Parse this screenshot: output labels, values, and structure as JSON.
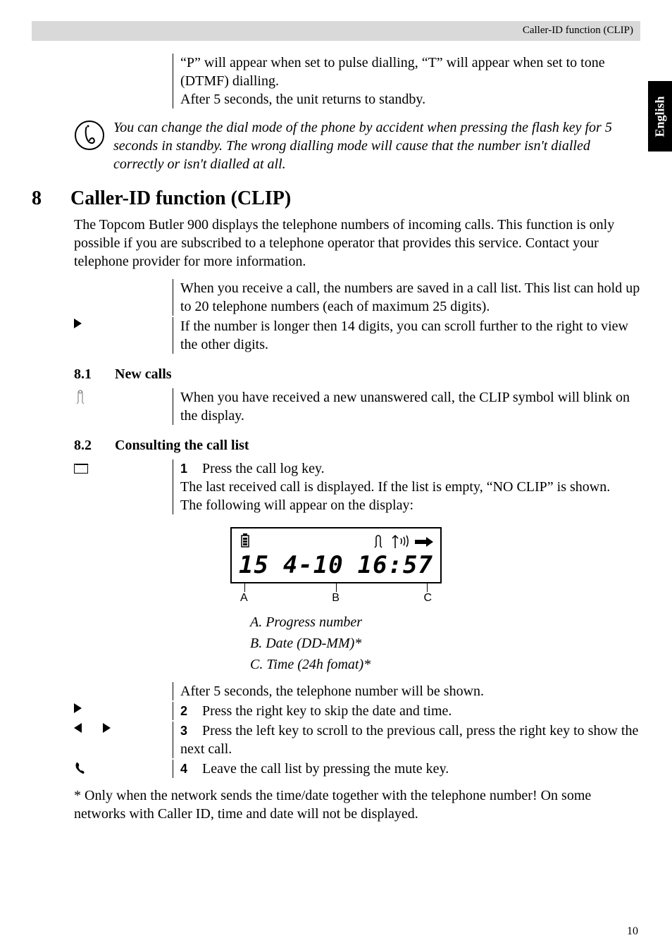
{
  "header": {
    "section_title": "Caller-ID function (CLIP)"
  },
  "side_tab": "English",
  "top_block": {
    "line1": "“P” will appear when set to pulse dialling, “T” will appear when set to tone (DTMF) dialling.",
    "line2": "After 5 seconds, the unit returns to standby."
  },
  "note": "You can change the dial mode of the phone by accident when pressing the flash key for 5 seconds in standby. The wrong dialling mode will cause that the number isn't dialled correctly or isn't dialled at all.",
  "section8": {
    "num": "8",
    "title": "Caller-ID function (CLIP)",
    "intro": "The Topcom Butler 900 displays the telephone numbers of incoming calls. This function is only possible if you are subscribed to a telephone operator that provides this service. Contact your telephone provider for more information.",
    "block1": "When you receive a call, the numbers are saved in a call list. This list can hold up to 20 telephone numbers (each of maximum 25 digits).",
    "block2": "If the number is longer then 14 digits, you can scroll further to the right to view the other digits."
  },
  "section81": {
    "num": "8.1",
    "title": "New calls",
    "text": "When you have received a new unanswered call, the CLIP symbol will blink on the display."
  },
  "section82": {
    "num": "8.2",
    "title": "Consulting the call list",
    "step1_num": "1",
    "step1": "Press the call log key.",
    "after1a": "The last received call is displayed. If the list is empty, “NO CLIP” is shown.",
    "after1b": "The following will appear on the display:",
    "display": {
      "progress": "15",
      "date": "4-10",
      "time": "16:57",
      "label_a": "A",
      "label_b": "B",
      "label_c": "C"
    },
    "legend_a": "A. Progress number",
    "legend_b": "B. Date (DD-MM)*",
    "legend_c": "C. Time (24h fomat)*",
    "after_display": "After 5 seconds, the telephone number will be shown.",
    "step2_num": "2",
    "step2": "Press the right key to skip the date and time.",
    "step3_num": "3",
    "step3": "Press the left key to scroll to the previous call, press the right key to show the next call.",
    "step4_num": "4",
    "step4": "Leave the call list by pressing the mute key."
  },
  "footnote": "* Only when the network sends the time/date together with the telephone number! On some networks with Caller ID, time and date will not be displayed.",
  "page_number": "10"
}
